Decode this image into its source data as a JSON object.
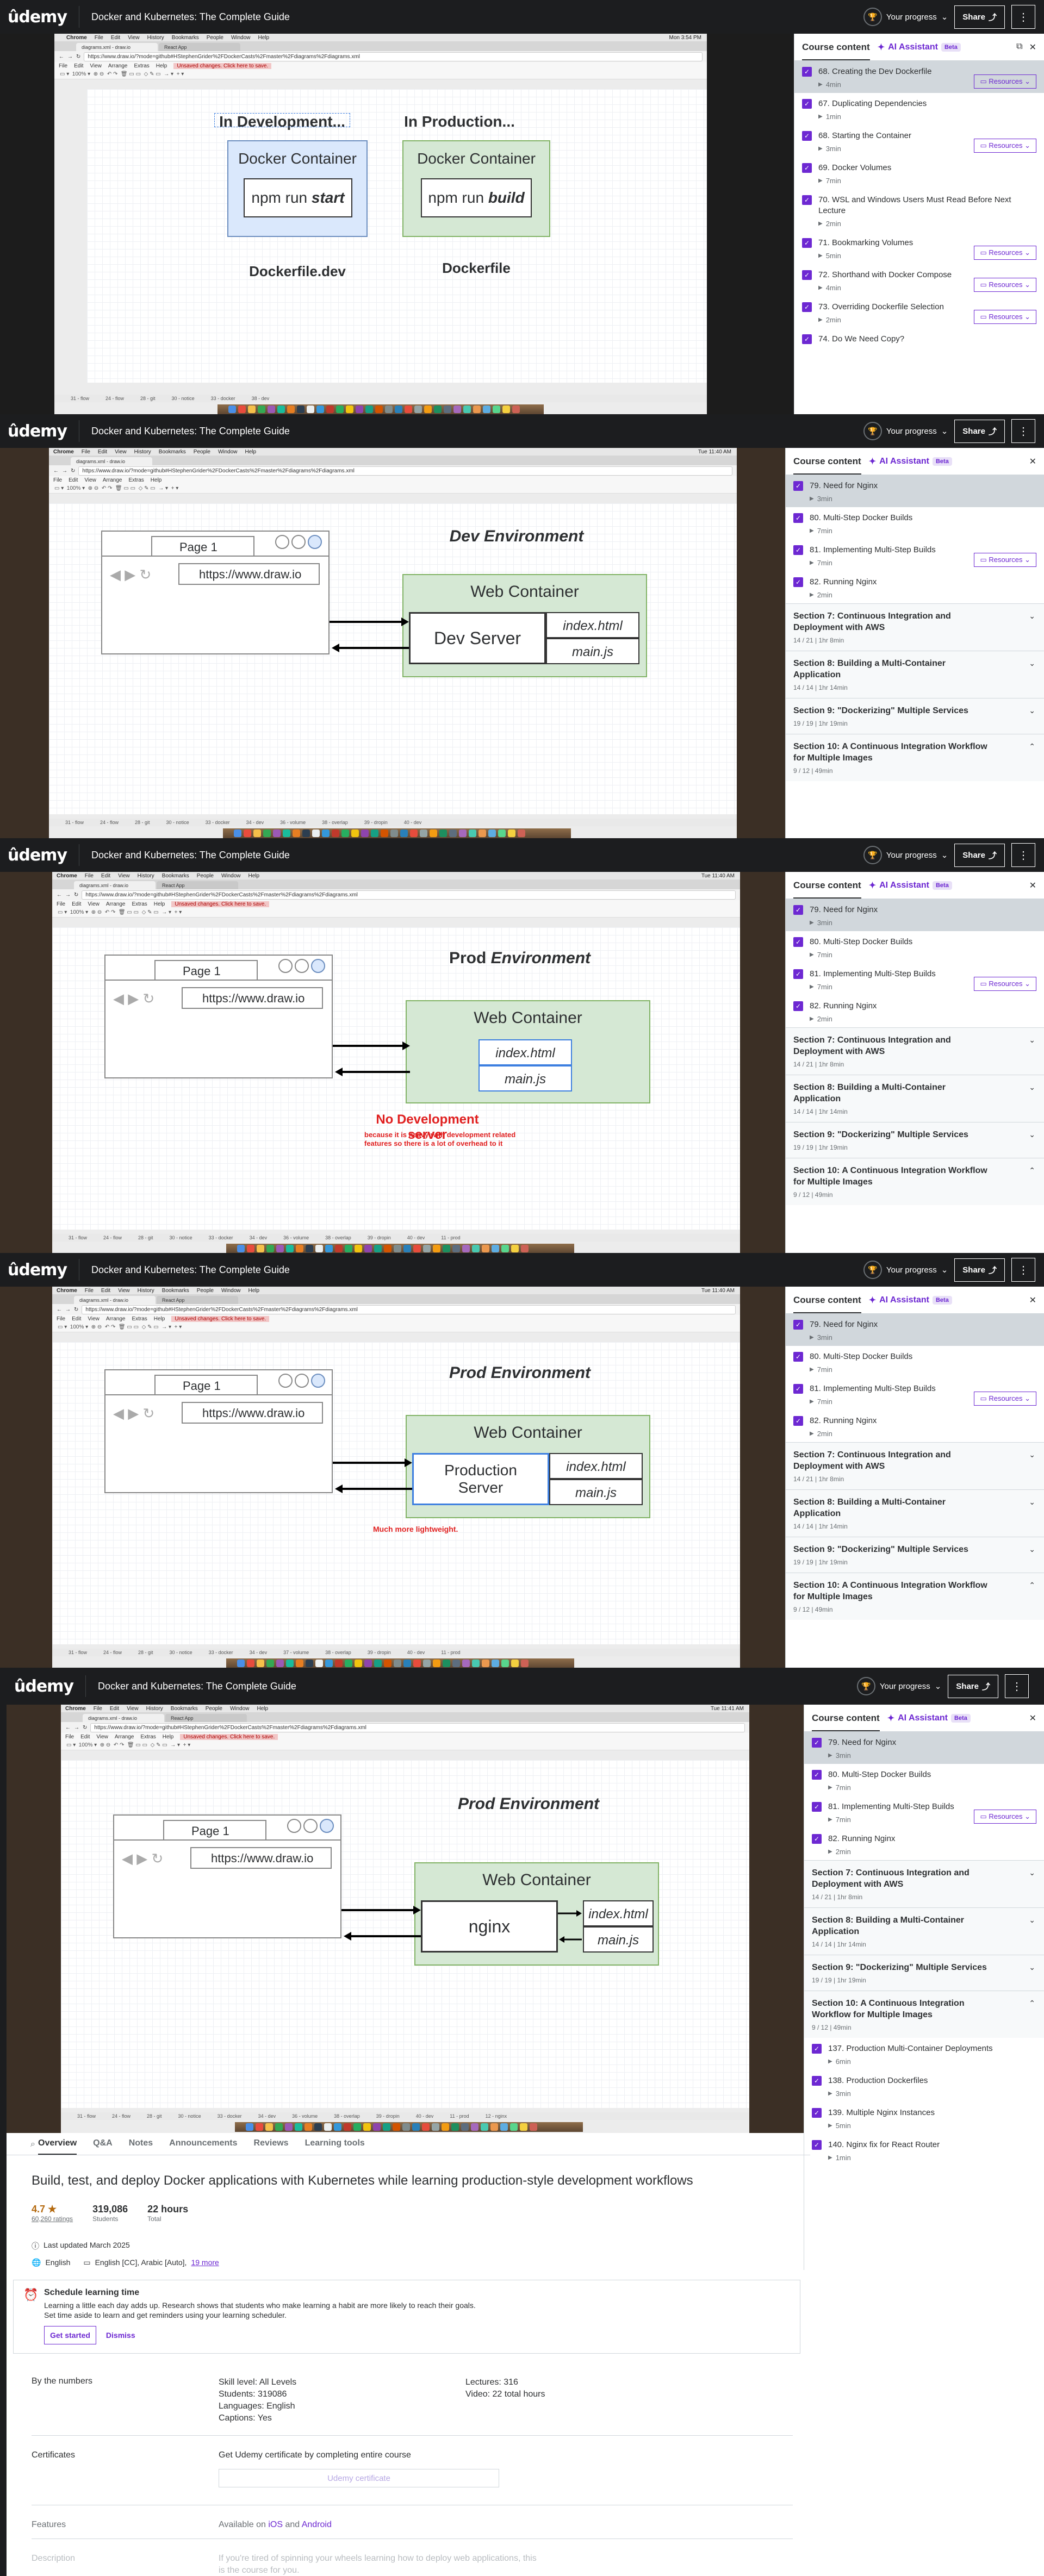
{
  "header": {
    "logo": "ûdemy",
    "course_title": "Docker and Kubernetes: The Complete Guide",
    "progress_label": "Your progress",
    "share_label": "Share",
    "more_label": "⋮"
  },
  "sidebar": {
    "tab_course": "Course content",
    "tab_ai": "AI Assistant",
    "beta": "Beta",
    "resources_label": "Resources"
  },
  "frame1": {
    "menubar": [
      "Chrome",
      "File",
      "Edit",
      "View",
      "History",
      "Bookmarks",
      "People",
      "Window",
      "Help"
    ],
    "clock": "Mon 3:54 PM",
    "tab": "diagrams.xml - draw.io",
    "tab2": "React App",
    "url": "https://www.draw.io/?mode=github#HStephenGrider%2FDockerCasts%2Fmaster%2Fdiagrams%2Fdiagrams.xml",
    "appmenu": [
      "File",
      "Edit",
      "View",
      "Arrange",
      "Extras",
      "Help"
    ],
    "warn": "Unsaved changes. Click here to save.",
    "dev_title": "In Development...",
    "prod_title": "In Production...",
    "dev_box": "Docker Container",
    "dev_cmd_prefix": "npm run ",
    "dev_cmd": "start",
    "prod_box": "Docker Container",
    "prod_cmd_prefix": "npm run ",
    "prod_cmd": "build",
    "dev_file": "Dockerfile.dev",
    "prod_file": "Dockerfile",
    "pagetabs": [
      "31 - flow",
      "24 - flow",
      "28 - git",
      "30 - notice",
      "33 - docker",
      "38 - dev"
    ],
    "lectures": [
      {
        "title": "68. Creating the Dev Dockerfile",
        "meta": "4min",
        "res": true,
        "active": true
      },
      {
        "title": "67. Duplicating Dependencies",
        "meta": "1min",
        "res": false
      },
      {
        "title": "68. Starting the Container",
        "meta": "3min",
        "res": true
      },
      {
        "title": "69. Docker Volumes",
        "meta": "7min",
        "res": false
      },
      {
        "title": "70. WSL and Windows Users Must Read Before Next Lecture",
        "meta": "2min",
        "res": false
      },
      {
        "title": "71. Bookmarking Volumes",
        "meta": "5min",
        "res": true
      },
      {
        "title": "72. Shorthand with Docker Compose",
        "meta": "4min",
        "res": true
      },
      {
        "title": "73. Overriding Dockerfile Selection",
        "meta": "2min",
        "res": true
      },
      {
        "title": "74. Do We Need Copy?",
        "meta": "",
        "res": false
      }
    ]
  },
  "frame2": {
    "clock": "Tue 11:40 AM",
    "title": "Dev Environment",
    "page_label": "Page 1",
    "page_url": "https://www.draw.io",
    "web_container": "Web Container",
    "server": "Dev Server",
    "file1": "index.html",
    "file2": "main.js",
    "pagetabs": [
      "31 - flow",
      "24 - flow",
      "28 - git",
      "30 - notice",
      "33 - docker",
      "34 - dev",
      "36 - volume",
      "38 - overlap",
      "39 - dropin",
      "40 - dev"
    ]
  },
  "frame3": {
    "clock": "Tue 11:40 AM",
    "title_a": "Prod",
    "title_b": "Environment",
    "page_label": "Page 1",
    "page_url": "https://www.draw.io",
    "web_container": "Web Container",
    "file1": "index.html",
    "file2": "main.js",
    "no_dev": "No Development server",
    "no_dev_note1": "because it is heavy with development related",
    "no_dev_note2": "features so there is a lot of overhead to it",
    "pagetabs": [
      "31 - flow",
      "24 - flow",
      "28 - git",
      "30 - notice",
      "33 - docker",
      "34 - dev",
      "36 - volume",
      "38 - overlap",
      "39 - dropin",
      "40 - dev",
      "11 - prod"
    ]
  },
  "frame4": {
    "clock": "Tue 11:40 AM",
    "title": "Prod Environment",
    "page_label": "Page 1",
    "page_url": "https://www.draw.io",
    "web_container": "Web Container",
    "server1": "Production",
    "server2": "Server",
    "file1": "index.html",
    "file2": "main.js",
    "note": "Much more lightweight.",
    "pagetabs": [
      "31 - flow",
      "24 - flow",
      "28 - git",
      "30 - notice",
      "33 - docker",
      "34 - dev",
      "37 - volume",
      "38 - overlap",
      "39 - dropin",
      "40 - dev",
      "11 - prod"
    ]
  },
  "frame5": {
    "clock": "Tue 11:41 AM",
    "title": "Prod Environment",
    "page_label": "Page 1",
    "page_url": "https://www.draw.io",
    "web_container": "Web Container",
    "server": "nginx",
    "file1": "index.html",
    "file2": "main.js",
    "pagetabs": [
      "31 - flow",
      "24 - flow",
      "28 - git",
      "30 - notice",
      "33 - docker",
      "34 - dev",
      "36 - volume",
      "38 - overlap",
      "39 - dropin",
      "40 - dev",
      "11 - prod",
      "12 - nginx"
    ]
  },
  "section_lectures_b": [
    {
      "title": "79. Need for Nginx",
      "meta": "3min",
      "res": false,
      "active": true
    },
    {
      "title": "80. Multi-Step Docker Builds",
      "meta": "7min",
      "res": false
    },
    {
      "title": "81. Implementing Multi-Step Builds",
      "meta": "7min",
      "res": true
    },
    {
      "title": "82. Running Nginx",
      "meta": "2min",
      "res": false
    }
  ],
  "sections": [
    {
      "title": "Section 7: Continuous Integration and Deployment with AWS",
      "meta": "14 / 21 | 1hr 8min",
      "chev": "⌄"
    },
    {
      "title": "Section 8: Building a Multi-Container Application",
      "meta": "14 / 14 | 1hr 14min",
      "chev": "⌄"
    },
    {
      "title": "Section 9: \"Dockerizing\" Multiple Services",
      "meta": "19 / 19 | 1hr 19min",
      "chev": "⌄"
    },
    {
      "title": "Section 10: A Continuous Integration Workflow for Multiple Images",
      "meta": "9 / 12 | 49min",
      "chev": "⌃"
    }
  ],
  "section10_lectures": [
    {
      "title": "137. Production Multi-Container Deployments",
      "meta": "6min"
    },
    {
      "title": "138. Production Dockerfiles",
      "meta": "3min"
    },
    {
      "title": "139. Multiple Nginx Instances",
      "meta": "5min"
    },
    {
      "title": "140. Nginx fix for React Router",
      "meta": "1min"
    }
  ],
  "below": {
    "tabs": [
      "Overview",
      "Q&A",
      "Notes",
      "Announcements",
      "Reviews",
      "Learning tools"
    ],
    "headline": "Build, test, and deploy Docker applications with Kubernetes while learning production-style development workflows",
    "rating": "4.7 ★",
    "ratings_count": "60,260 ratings",
    "students_n": "319,086",
    "students_l": "Students",
    "hours_n": "22 hours",
    "hours_l": "Total",
    "updated": "Last updated March 2025",
    "lang": "English",
    "captions": "English [CC], Arabic [Auto],",
    "more": "19 more",
    "sched_title": "Schedule learning time",
    "sched_text1": "Learning a little each day adds up. Research shows that students who make learning a habit are more likely to reach their goals.",
    "sched_text2": "Set time aside to learn and get reminders using your learning scheduler.",
    "get_started": "Get started",
    "dismiss": "Dismiss",
    "by_numbers": "By the numbers",
    "skill": "Skill level: All Levels",
    "students": "Students: 319086",
    "languages": "Languages: English",
    "captions2": "Captions: Yes",
    "lectures": "Lectures: 316",
    "video": "Video: 22 total hours",
    "certificates": "Certificates",
    "cert_text": "Get Udemy certificate by completing entire course",
    "cert_btn": "Udemy certificate",
    "features": "Features",
    "avail": "Available on",
    "ios": "iOS",
    "and": "and",
    "android": "Android",
    "description": "Description",
    "desc_text1": "If you're tired of spinning your wheels learning how to deploy web applications, this",
    "desc_text2": "is the course for you."
  },
  "colors": {
    "accent": "#6d28d2",
    "green_fill": "#d5e8d4",
    "green_border": "#82b366",
    "blue_fill": "#dae8fc",
    "blue_border": "#6c8ebf",
    "topbar": "#1c1d1f",
    "red": "#e01f1f"
  }
}
